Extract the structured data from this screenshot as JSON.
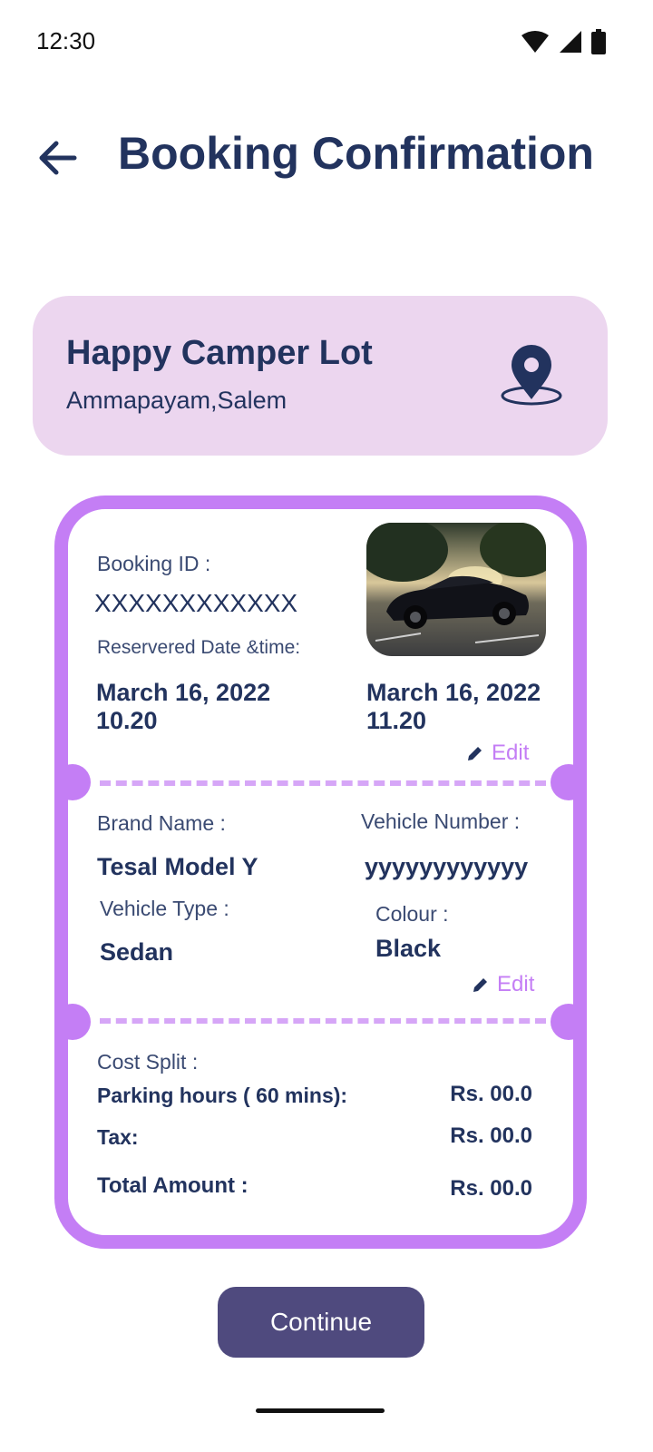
{
  "status_bar": {
    "time": "12:30",
    "icons": [
      "wifi-icon",
      "signal-icon",
      "battery-icon"
    ]
  },
  "header": {
    "title": "Booking Confirmation",
    "back_icon": "arrow-left-icon"
  },
  "location": {
    "name": "Happy Camper Lot",
    "address": "Ammapayam,Salem",
    "icon": "map-pin-icon"
  },
  "booking": {
    "id_label": "Booking ID :",
    "id_value": "XXXXXXXXXXXX",
    "date_label": "Reservered Date &time:",
    "start_date": "March 16, 2022",
    "start_time": "10.20",
    "end_date": "March 16, 2022",
    "end_time": "11.20",
    "edit_label": "Edit"
  },
  "vehicle": {
    "brand_label": "Brand Name :",
    "brand_value": "Tesal Model Y",
    "number_label": "Vehicle Number :",
    "number_value": "yyyyyyyyyyyy",
    "type_label": "Vehicle Type :",
    "type_value": "Sedan",
    "colour_label": "Colour :",
    "colour_value": "Black",
    "edit_label": "Edit"
  },
  "cost": {
    "title": "Cost Split :",
    "rows": [
      {
        "label": "Parking hours ( 60 mins):",
        "value": "Rs. 00.0"
      },
      {
        "label": "Tax:",
        "value": "Rs. 00.0"
      }
    ],
    "total_label": "Total Amount :",
    "total_value": "Rs. 00.0"
  },
  "actions": {
    "continue_label": "Continue"
  },
  "colors": {
    "primary": "#22335e",
    "accent": "#c47ef5",
    "card_bg": "#ecd6ef",
    "button": "#4f4a7e"
  }
}
